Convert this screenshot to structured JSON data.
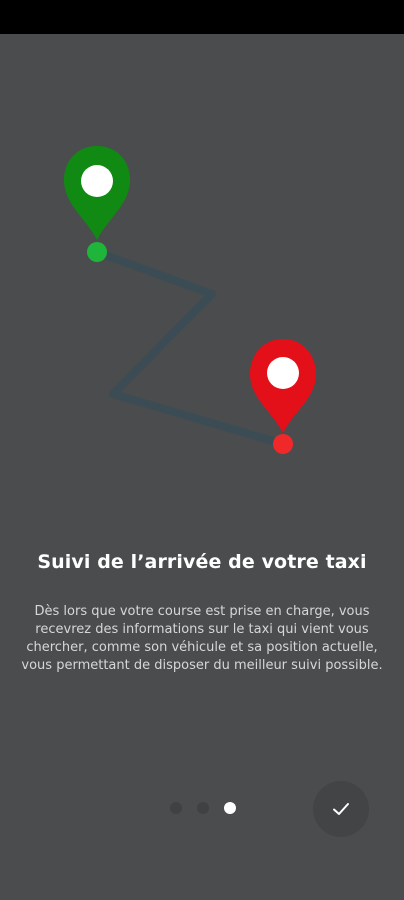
{
  "onboarding": {
    "title": "Suivi de l’arrivée de votre taxi",
    "description": "Dès lors que votre course est prise en charge, vous recevrez des informations sur le taxi qui vient vous chercher, comme son véhicule et sa position actuelle, vous permettant de disposer du meilleur suivi possible.",
    "page_indicator": {
      "total_pages": 3,
      "current_page": 3
    },
    "done_icon": "checkmark-icon"
  },
  "colors": {
    "background": "#4a4c4d",
    "start_pin": "#118a14",
    "start_dot": "#1fb53a",
    "end_pin": "#e3101a",
    "end_dot": "#f0282a",
    "route": "#3b4c55"
  }
}
